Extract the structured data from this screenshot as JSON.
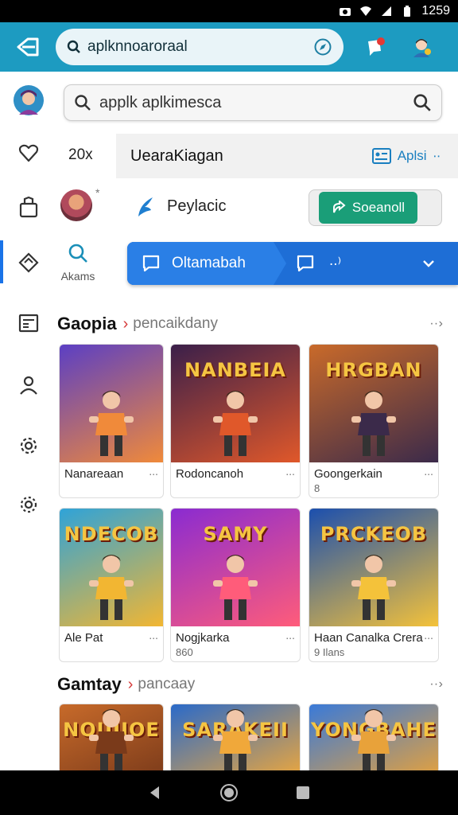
{
  "status_bar": {
    "time": "1259"
  },
  "app_bar": {
    "search_value": "aplknnoarorаal"
  },
  "search": {
    "value": "apрlk aplkimesca"
  },
  "filter_row": {
    "count": "20x",
    "label": "UearaKiagan",
    "action_label": "Aplsi"
  },
  "profile_row": {
    "sep": "*",
    "label": "Peylacic",
    "toggle_label": "Soeanoll"
  },
  "account_row": {
    "label": "Akams",
    "tab_label": "Oltamabah"
  },
  "section1": {
    "title": "Gaopia",
    "subtitle": "pencaikdany",
    "cards": [
      {
        "name": "Nanareaan",
        "art_title": "",
        "colors": [
          "#5b3fc4",
          "#f08a3a"
        ]
      },
      {
        "name": "Rodoncanoh",
        "art_title": "NANBEIA",
        "colors": [
          "#3a1f4a",
          "#e0582a"
        ]
      },
      {
        "name": "Goongerkain",
        "meta": "8",
        "art_title": "HRGBAN",
        "colors": [
          "#c96a2a",
          "#3b2a4a"
        ]
      },
      {
        "name": "Ale Pat",
        "art_title": "NDECOB",
        "colors": [
          "#2fa3d8",
          "#f2b632"
        ]
      },
      {
        "name": "Nogjkarka",
        "meta": "860",
        "art_title": "SAMY",
        "colors": [
          "#8a2bd1",
          "#ff5c7a"
        ]
      },
      {
        "name": "Haan Canalka Crera",
        "meta": "9 Ilans",
        "art_title": "PRCKEOB",
        "colors": [
          "#1b4fae",
          "#f4c23a"
        ]
      }
    ]
  },
  "section2": {
    "title": "Gamtay",
    "subtitle": "pancaay",
    "cards": [
      {
        "art_title": "NOUIIOE",
        "colors": [
          "#c76a2a",
          "#7a3a1a"
        ]
      },
      {
        "art_title": "SARAKEII",
        "colors": [
          "#2a6ac9",
          "#f0a83a"
        ]
      },
      {
        "art_title": "YONGBAHE",
        "colors": [
          "#3a7ad8",
          "#e8a23a"
        ]
      }
    ]
  },
  "colors": {
    "accent": "#1d9bc1",
    "blue_tab": "#1e6ed6",
    "green": "#1a9e78"
  }
}
